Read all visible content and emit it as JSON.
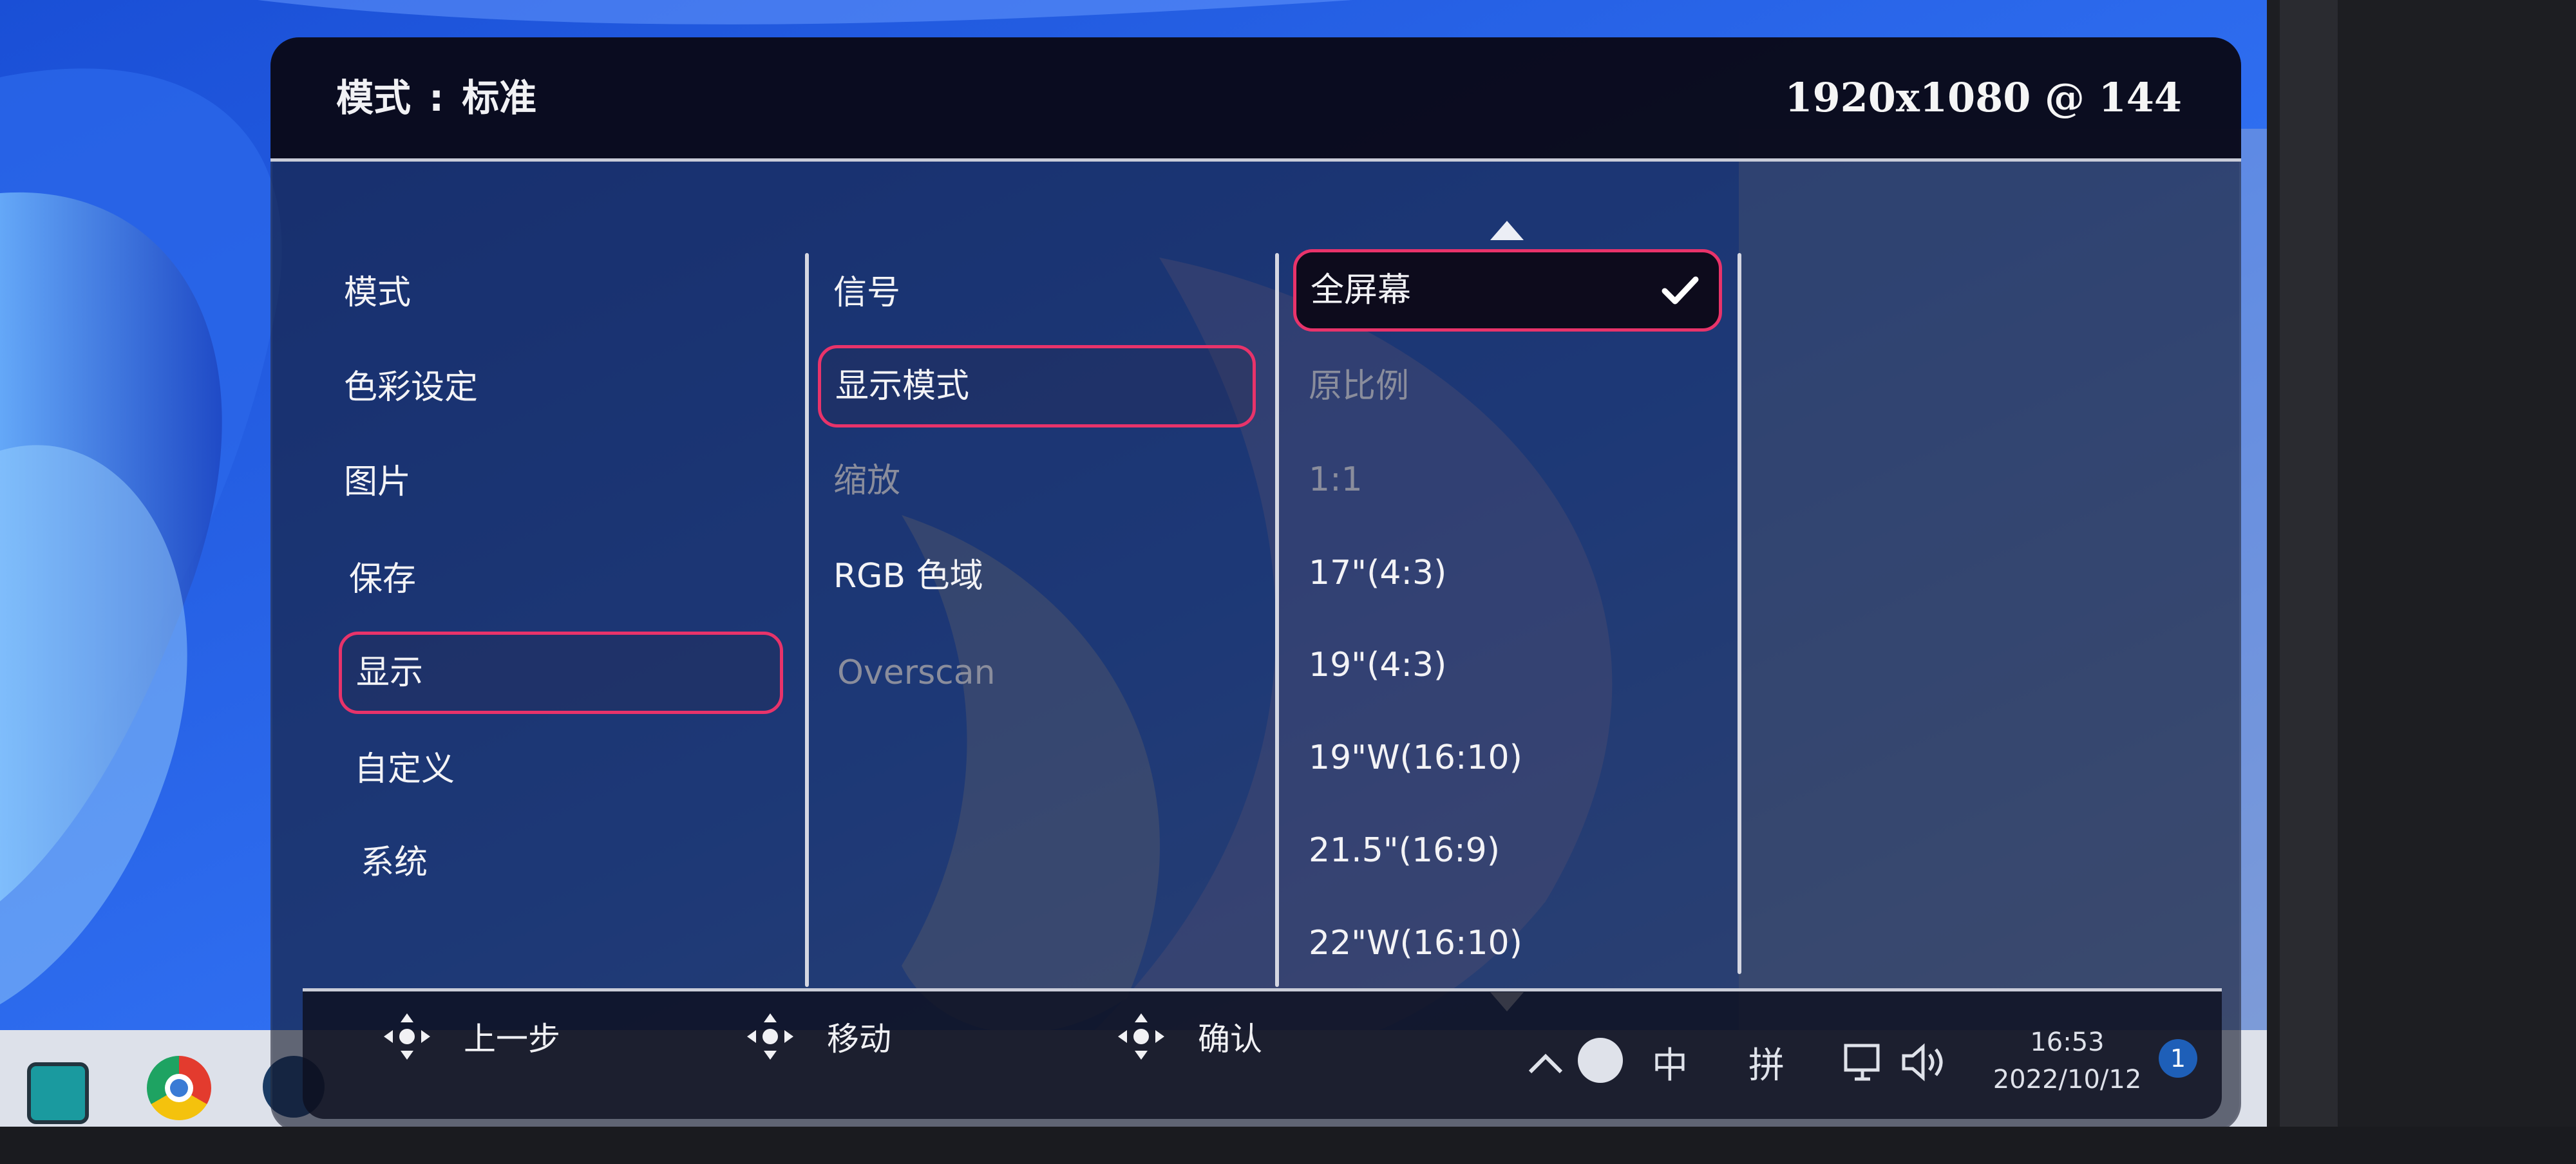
{
  "header": {
    "mode_label": "模式",
    "colon": ":",
    "mode_value": "标准",
    "resolution": "1920x1080 @ 144"
  },
  "menu": {
    "main_items": [
      "模式",
      "色彩设定",
      "图片",
      "保存",
      "显示",
      "自定义",
      "系统"
    ],
    "main_selected": "显示",
    "sub_items": [
      "信号",
      "显示模式",
      "缩放",
      "RGB 色域",
      "Overscan"
    ],
    "sub_disabled": [
      "缩放",
      "Overscan"
    ],
    "sub_selected": "显示模式",
    "option_items": [
      "全屏幕",
      "原比例",
      "1:1",
      "17\"(4:3)",
      "19\"(4:3)",
      "19\"W(16:10)",
      "21.5\"(16:9)",
      "22\"W(16:10)"
    ],
    "option_disabled": [
      "原比例",
      "1:1"
    ],
    "option_active": "全屏幕"
  },
  "footer": {
    "back": "上一步",
    "move": "移动",
    "confirm": "确认"
  },
  "taskbar": {
    "tray_ime_1": "中",
    "tray_ime_2": "拼",
    "time": "16:53",
    "date": "2022/10/12",
    "notification_count": "1"
  },
  "colors": {
    "highlight": "#e8336a",
    "osd_header": "#0a0a1a",
    "divider": "#d5d7e2"
  },
  "icons": [
    "check-icon",
    "arrow-up-icon",
    "arrow-down-icon",
    "dpad-icon",
    "chrome-icon",
    "steam-icon",
    "network-icon",
    "volume-icon",
    "caret-up-icon"
  ]
}
